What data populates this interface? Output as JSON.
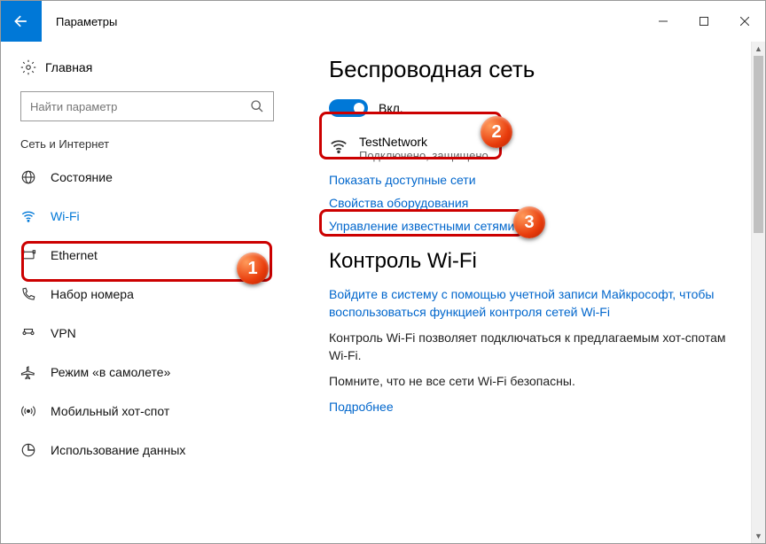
{
  "window": {
    "title": "Параметры"
  },
  "sidebar": {
    "home": "Главная",
    "search_placeholder": "Найти параметр",
    "section": "Сеть и Интернет",
    "items": [
      {
        "label": "Состояние"
      },
      {
        "label": "Wi-Fi"
      },
      {
        "label": "Ethernet"
      },
      {
        "label": "Набор номера"
      },
      {
        "label": "VPN"
      },
      {
        "label": "Режим «в самолете»"
      },
      {
        "label": "Мобильный хот-спот"
      },
      {
        "label": "Использование данных"
      }
    ]
  },
  "main": {
    "heading1": "Беспроводная сеть",
    "toggle_label": "Вкл.",
    "network_name": "TestNetwork",
    "network_status": "Подключено, защищено",
    "link_show_networks": "Показать доступные сети",
    "link_hardware": "Свойства оборудования",
    "link_manage": "Управление известными сетями",
    "heading2": "Контроль Wi-Fi",
    "link_signin": "Войдите в систему с помощью учетной записи Майкрософт, чтобы воспользоваться функцией контроля сетей Wi-Fi",
    "body1": "Контроль Wi-Fi позволяет подключаться к предлагаемым хот-спотам Wi-Fi.",
    "body2": "Помните, что не все сети Wi-Fi безопасны.",
    "link_more": "Подробнее"
  },
  "annotations": {
    "b1": "1",
    "b2": "2",
    "b3": "3"
  }
}
